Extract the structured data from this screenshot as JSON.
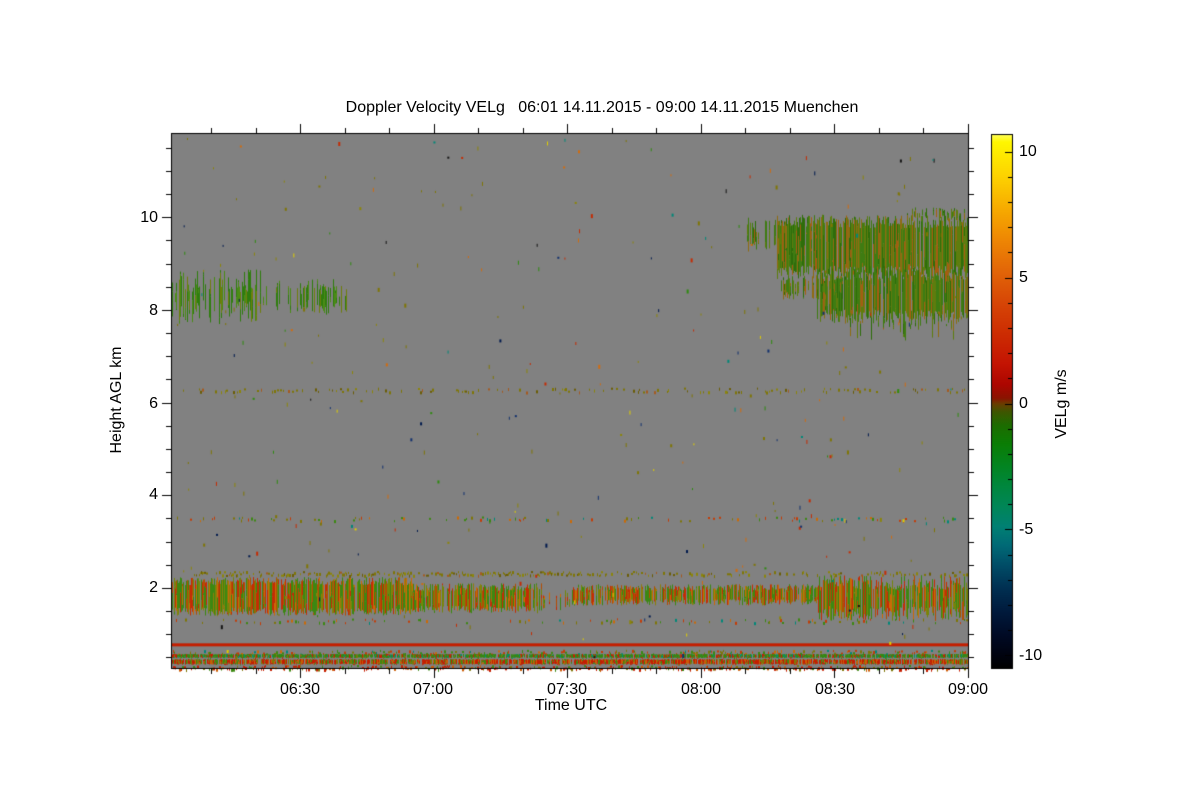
{
  "page": {
    "background": "#ffffff"
  },
  "chart_data": {
    "type": "heatmap",
    "title": "Doppler Velocity VELg   06:01 14.11.2015 - 09:00 14.11.2015 Muenchen",
    "xlabel": "Time UTC",
    "ylabel": "Height AGL km",
    "background_color": "#818181",
    "x_axis": {
      "start_time": "06:01",
      "end_time": "09:00",
      "tick_labels": [
        "06:30",
        "07:00",
        "07:30",
        "08:00",
        "08:30",
        "09:00"
      ],
      "tick_minutes": [
        30,
        60,
        90,
        120,
        150,
        180
      ],
      "minor_step_minutes": 10,
      "range_minutes": [
        1,
        180
      ]
    },
    "y_axis": {
      "range_km": [
        0.27,
        11.82
      ],
      "tick_labels": [
        "10",
        "8",
        "6",
        "4",
        "2"
      ],
      "tick_values": [
        10,
        8,
        6,
        4,
        2
      ],
      "minor_step_km": 0.5
    },
    "colorbar": {
      "label": "VELg m/s",
      "range": [
        -10.5,
        10.7
      ],
      "tick_labels": [
        "10",
        "5",
        "0",
        "-5",
        "-10"
      ],
      "tick_values": [
        10,
        5,
        0,
        -5,
        -10
      ],
      "minor_step": 1,
      "gradient": [
        [
          0.0,
          "#ffff60"
        ],
        [
          0.015,
          "#fff700"
        ],
        [
          0.08,
          "#fdd200"
        ],
        [
          0.14,
          "#f7ab00"
        ],
        [
          0.2,
          "#ee8604"
        ],
        [
          0.26,
          "#e26408"
        ],
        [
          0.32,
          "#d64406"
        ],
        [
          0.38,
          "#cc2a02"
        ],
        [
          0.43,
          "#c41402"
        ],
        [
          0.47,
          "#ac0600"
        ],
        [
          0.495,
          "#8a1400"
        ],
        [
          0.505,
          "#6b3c00"
        ],
        [
          0.52,
          "#3f5600"
        ],
        [
          0.545,
          "#1d6c00"
        ],
        [
          0.58,
          "#0b7d05"
        ],
        [
          0.62,
          "#038420"
        ],
        [
          0.66,
          "#00873e"
        ],
        [
          0.7,
          "#008659"
        ],
        [
          0.735,
          "#008073"
        ],
        [
          0.77,
          "#006a76"
        ],
        [
          0.81,
          "#004b66"
        ],
        [
          0.85,
          "#003052"
        ],
        [
          0.895,
          "#001a3c"
        ],
        [
          0.94,
          "#000a24"
        ],
        [
          0.975,
          "#000310"
        ],
        [
          1.0,
          "#000000"
        ]
      ]
    },
    "palettes": {
      "greenCloud": [
        [
          "#2f7d0e",
          5
        ],
        [
          "#4b8c16",
          3
        ],
        [
          "#6f7f0c",
          2
        ]
      ],
      "rightCloud": [
        [
          "#3f7c12",
          4
        ],
        [
          "#5e7d0e",
          3
        ],
        [
          "#8f6c12",
          2
        ],
        [
          "#a55d12",
          1
        ],
        [
          "#2e6d0a",
          2
        ]
      ],
      "blBand": [
        [
          "#3c8812",
          4
        ],
        [
          "#74860a",
          2
        ],
        [
          "#b34e04",
          2
        ],
        [
          "#c42c04",
          2
        ],
        [
          "#8e7e0a",
          1
        ],
        [
          "#cb6a06",
          1
        ]
      ],
      "oliveDots": [
        [
          "#7f7606",
          6
        ],
        [
          "#8c860a",
          3
        ],
        [
          "#6b5d05",
          2
        ],
        [
          "#a55a20",
          1
        ]
      ],
      "bottomRed": [
        [
          "#c41e00",
          5
        ],
        [
          "#cb5c04",
          2
        ],
        [
          "#7f7606",
          2
        ],
        [
          "#3c8812",
          2
        ]
      ],
      "bottomGreen": [
        [
          "#338812",
          6
        ],
        [
          "#c41e00",
          2
        ],
        [
          "#7f7606",
          1
        ],
        [
          "#00906a",
          1
        ]
      ],
      "mixSpecks": [
        [
          "#c43c06",
          3
        ],
        [
          "#3c8812",
          3
        ],
        [
          "#7f7606",
          2
        ],
        [
          "#008878",
          1
        ],
        [
          "#cb6a06",
          1
        ]
      ],
      "noisePalette": [
        [
          "#7f7606",
          5
        ],
        [
          "#8c860a",
          3
        ],
        [
          "#c42c04",
          2
        ],
        [
          "#d06c10",
          2
        ],
        [
          "#2f8b10",
          2
        ],
        [
          "#e0ce00",
          1
        ],
        [
          "#008878",
          1
        ],
        [
          "#12316e",
          1
        ],
        [
          "#001a4e",
          1
        ],
        [
          "#141414",
          1
        ]
      ]
    },
    "features": [
      {
        "type": "streaks",
        "t": [
          1,
          21
        ],
        "h": [
          7.85,
          8.72
        ],
        "density": 0.6,
        "jitter": 0.3,
        "palette": "greenCloud",
        "note": "cirrus patch 06:01-06:22 ~8.3 km"
      },
      {
        "type": "streaks",
        "t": [
          21,
          38
        ],
        "h": [
          8.0,
          8.55
        ],
        "density": 0.22,
        "jitter": 0.35,
        "palette": "greenCloud"
      },
      {
        "type": "streaks",
        "t": [
          30,
          41
        ],
        "h": [
          8.0,
          8.48
        ],
        "density": 0.4,
        "jitter": 0.3,
        "palette": "greenCloud"
      },
      {
        "type": "streaks",
        "t": [
          137,
          179.8
        ],
        "h": [
          8.75,
          9.97
        ],
        "density": 0.93,
        "jitter": 0.12,
        "palette": "rightCloud",
        "note": "large cloud 08:17-09:00 ~9-10 km"
      },
      {
        "type": "streaks",
        "t": [
          146,
          179.8
        ],
        "h": [
          7.78,
          8.85
        ],
        "density": 0.85,
        "jitter": 0.15,
        "palette": "rightCloud"
      },
      {
        "type": "streaks",
        "t": [
          130,
          146
        ],
        "h": [
          9.3,
          9.9
        ],
        "density": 0.5,
        "jitter": 0.3,
        "palette": "rightCloud"
      },
      {
        "type": "streaks",
        "t": [
          138,
          152
        ],
        "h": [
          8.28,
          8.7
        ],
        "density": 0.55,
        "jitter": 0.25,
        "palette": "rightCloud"
      },
      {
        "type": "streaks",
        "t": [
          152,
          178
        ],
        "h": [
          7.45,
          7.95
        ],
        "density": 0.3,
        "jitter": 0.4,
        "palette": "rightCloud"
      },
      {
        "type": "streaks",
        "t": [
          166,
          179.8
        ],
        "h": [
          9.95,
          10.18
        ],
        "density": 0.45,
        "jitter": 0.3,
        "palette": "rightCloud"
      },
      {
        "type": "dashline",
        "t": [
          3,
          179.5
        ],
        "h": 6.28,
        "density": 0.2,
        "palette": "oliveDots",
        "note": "sparse echo line ~6.3 km"
      },
      {
        "type": "dashline",
        "t": [
          1,
          179.5
        ],
        "h": 3.5,
        "density": 0.15,
        "palette": "mixSpecks",
        "note": "sparse echo line ~3.5 km"
      },
      {
        "type": "dashline",
        "t": [
          6,
          96
        ],
        "h": 2.32,
        "density": 0.5,
        "palette": "oliveDots",
        "note": "dotted layer ~2.3 km"
      },
      {
        "type": "dashline",
        "t": [
          96,
          179.5
        ],
        "h": 2.32,
        "density": 0.25,
        "palette": "oliveDots"
      },
      {
        "type": "streaks",
        "t": [
          1,
          55
        ],
        "h": [
          1.45,
          2.18
        ],
        "density": 0.94,
        "jitter": 0.12,
        "palette": "blBand",
        "note": "boundary layer band ~1.5-2.2 km"
      },
      {
        "type": "streaks",
        "t": [
          55,
          84
        ],
        "h": [
          1.5,
          2.05
        ],
        "density": 0.86,
        "jitter": 0.15,
        "palette": "blBand"
      },
      {
        "type": "streaks",
        "t": [
          84,
          91
        ],
        "h": [
          1.55,
          1.9
        ],
        "density": 0.4,
        "jitter": 0.3,
        "palette": "blBand"
      },
      {
        "type": "streaks",
        "t": [
          91,
          146
        ],
        "h": [
          1.66,
          2.04
        ],
        "density": 0.8,
        "jitter": 0.18,
        "palette": "blBand"
      },
      {
        "type": "streaks",
        "t": [
          146,
          179.8
        ],
        "h": [
          1.38,
          2.18
        ],
        "density": 0.88,
        "jitter": 0.2,
        "palette": "blBand"
      },
      {
        "type": "dashline",
        "t": [
          1,
          179.5
        ],
        "h": 1.3,
        "density": 0.13,
        "palette": "mixSpecks"
      },
      {
        "type": "hline",
        "h": 0.77,
        "thickness": 3,
        "color": "#c41e00",
        "note": "solid red line ~0.8 km"
      },
      {
        "type": "dashline",
        "t": [
          1,
          179.8
        ],
        "h": 0.62,
        "density": 0.3,
        "palette": "mixSpecks"
      },
      {
        "type": "streaks",
        "t": [
          1,
          179.8
        ],
        "h": [
          0.49,
          0.57
        ],
        "density": 0.9,
        "jitter": 0.1,
        "palette": "bottomGreen",
        "note": "near-ground green band"
      },
      {
        "type": "streaks",
        "t": [
          1,
          179.8
        ],
        "h": [
          0.35,
          0.46
        ],
        "density": 0.92,
        "jitter": 0.1,
        "palette": "bottomRed",
        "note": "near-ground red band"
      },
      {
        "type": "dashline",
        "t": [
          1,
          179.8
        ],
        "h": 0.29,
        "density": 0.5,
        "palette": "bottomRed"
      },
      {
        "type": "noise",
        "count": 300,
        "palette": "noisePalette",
        "note": "random speckle over grey field"
      }
    ]
  }
}
